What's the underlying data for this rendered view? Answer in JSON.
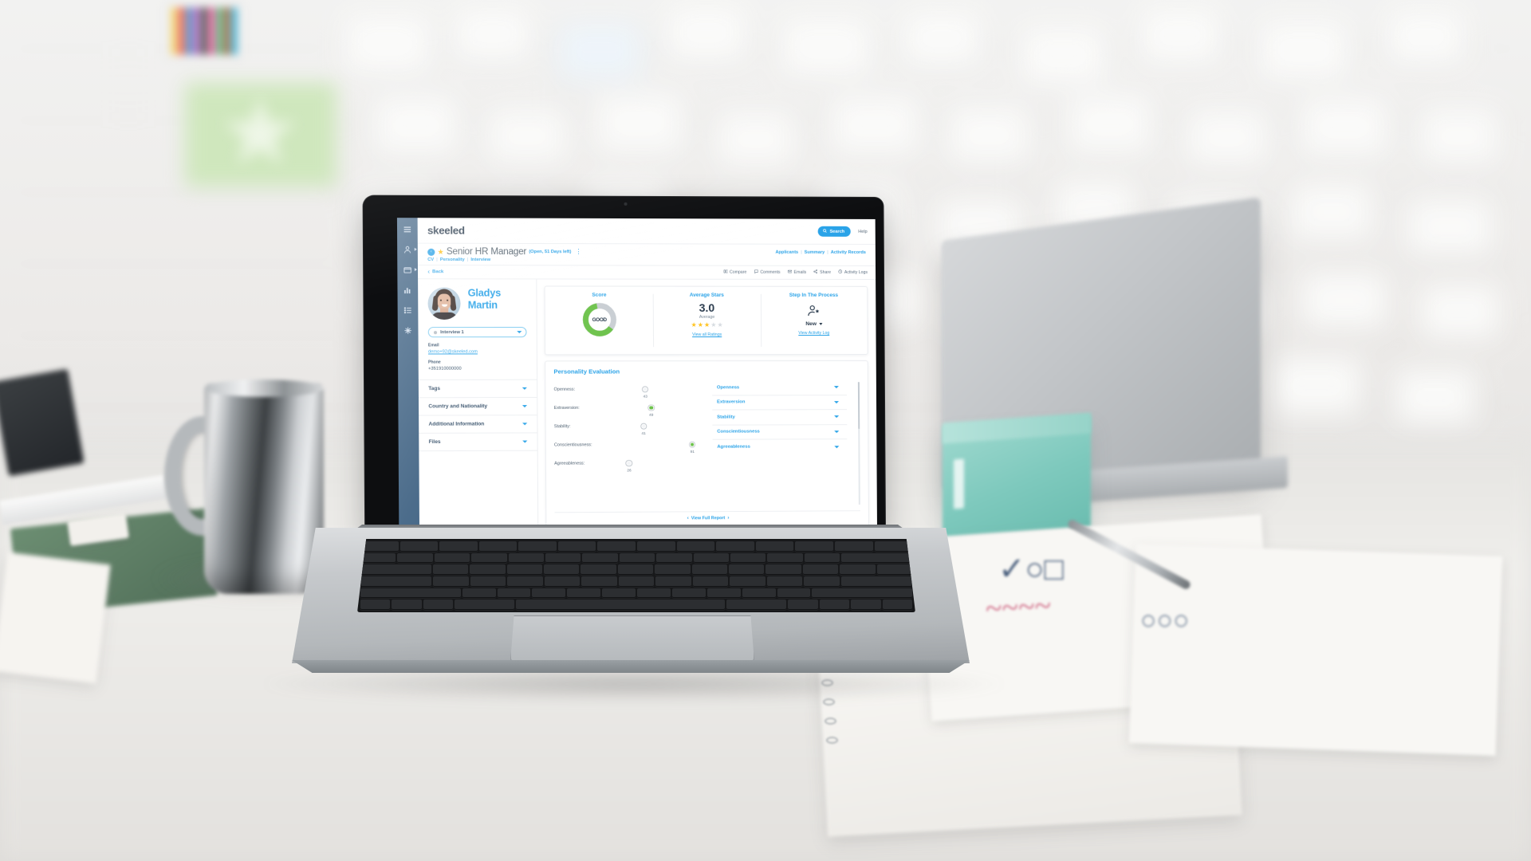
{
  "app": {
    "logo": "skeeled",
    "logo_dot": "",
    "search_label": "Search",
    "help_label": "Help"
  },
  "sidebar": {
    "items": [
      {
        "name": "menu",
        "icon": "hamburger-icon",
        "label": "Menu",
        "active": false
      },
      {
        "name": "candidates",
        "icon": "person-icon",
        "label": "Candidates",
        "active": false
      },
      {
        "name": "vacancies",
        "icon": "folder-icon",
        "label": "Vacancies",
        "active": false
      },
      {
        "name": "analytics",
        "icon": "bar-chart-icon",
        "label": "Analytics",
        "active": false
      },
      {
        "name": "lists",
        "icon": "list-icon",
        "label": "Lists",
        "active": false
      },
      {
        "name": "ai-matching",
        "icon": "sparkle-icon",
        "label": "AI Matching",
        "active": false
      }
    ]
  },
  "job": {
    "badge": "‹",
    "star": "★",
    "title": "Senior HR Manager",
    "status": "(Open, 51 Days left)",
    "kebab": "⋮",
    "tabs": [
      {
        "label": "CV",
        "active": false
      },
      {
        "label": "Personality",
        "active": true
      },
      {
        "label": "Interview",
        "active": false
      }
    ],
    "tab_separator": "|",
    "right_links": [
      {
        "label": "Applicants"
      },
      {
        "label": "Summary"
      },
      {
        "label": "Activity Records"
      }
    ]
  },
  "toolbar": {
    "back_label": "Back",
    "back_chevron": "‹",
    "tools": [
      {
        "label": "Compare",
        "icon": "compare-icon"
      },
      {
        "label": "Comments",
        "icon": "comment-icon"
      },
      {
        "label": "Emails",
        "icon": "envelope-icon"
      },
      {
        "label": "Share",
        "icon": "share-icon"
      },
      {
        "label": "Activity Logs",
        "icon": "clock-icon"
      }
    ]
  },
  "profile": {
    "first_name": "Gladys",
    "last_name": "Martin",
    "avatar_alt": "candidate-photo",
    "interview_select": {
      "value": "Interview 1",
      "options": [
        "Interview 1"
      ]
    },
    "email_label": "Email",
    "email_value": "demo+92@skeeled.com",
    "phone_label": "Phone",
    "phone_value": "+351910000000",
    "accordions": [
      {
        "label": "Tags"
      },
      {
        "label": "Country and Nationality"
      },
      {
        "label": "Additional Information"
      },
      {
        "label": "Files"
      }
    ]
  },
  "stats": {
    "score": {
      "title": "Score",
      "donut_label": "GOOD",
      "percent": 62,
      "track_color": "#c9ced3",
      "value_color": "#6cc24a"
    },
    "average_stars": {
      "title": "Average Stars",
      "value": "3.0",
      "sub": "Average",
      "filled": 3,
      "total": 5,
      "link": "View all Ratings",
      "star_color": "#ffc31f"
    },
    "step": {
      "title": "Step In The Process",
      "icon": "person-star-icon",
      "value": "New",
      "link": "View Activity Log"
    }
  },
  "personality": {
    "title": "Personality Evaluation",
    "sliders": [
      {
        "label": "Openness:",
        "value": 43,
        "knob": "grey"
      },
      {
        "label": "Extraversion:",
        "value": 49,
        "knob": "green"
      },
      {
        "label": "Stability:",
        "value": 41,
        "knob": "grey"
      },
      {
        "label": "Conscientiousness:",
        "value": 91,
        "knob": "green"
      },
      {
        "label": "Agreeableness:",
        "value": 26,
        "knob": "grey"
      }
    ],
    "traits": [
      {
        "label": "Openness"
      },
      {
        "label": "Extraversion"
      },
      {
        "label": "Stability"
      },
      {
        "label": "Conscientiousness"
      },
      {
        "label": "Agreeableness"
      }
    ],
    "view_full": "View Full Report",
    "view_full_chevrons": {
      "left": "‹",
      "right": "›"
    }
  },
  "colors": {
    "accent_blue": "#2aa3e8",
    "sidebar_blue": "#3e6182",
    "green": "#6cc24a",
    "yellow": "#ffc31f",
    "dark_text": "#2b3c4e"
  }
}
